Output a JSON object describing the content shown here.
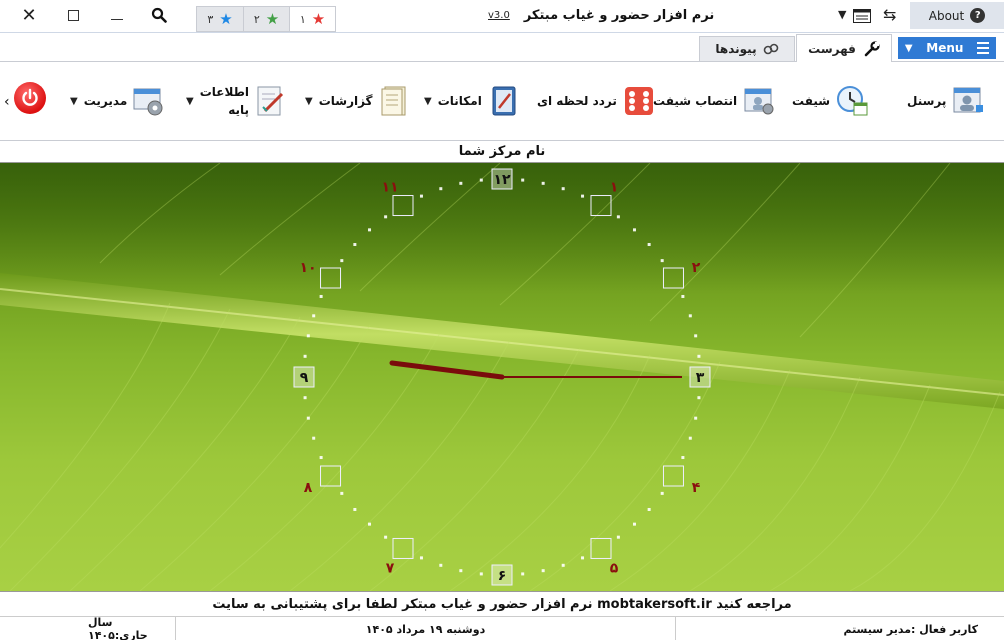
{
  "window": {
    "title": "نرم افزار حضور و غیاب مبتکر",
    "version": "v3.0",
    "about_label": "About"
  },
  "favorites": [
    {
      "label": "۱",
      "color": "#e53935"
    },
    {
      "label": "۲",
      "color": "#43a047"
    },
    {
      "label": "۳",
      "color": "#1e88e5"
    }
  ],
  "tabs": {
    "menu_button": "Menu",
    "index": "فهرست",
    "links": "پیوندها"
  },
  "ribbon": {
    "personnel": "پرسنل",
    "shift": "شیفت",
    "shift_assign": "انتصاب شیفت",
    "instant_traffic": "تردد لحظه ای",
    "facilities": "امکانات",
    "reports": "گزارشات",
    "base_info_line1": "اطلاعات",
    "base_info_line2": "پایه",
    "management": "مدیریت"
  },
  "center_name": "نام مرکز شما",
  "clock": {
    "numerals": [
      "۱۲",
      "۱",
      "۲",
      "۳",
      "۴",
      "۵",
      "۶",
      "۷",
      "۸",
      "۹",
      "۱۰",
      "۱۱"
    ],
    "hands_color": "#7a0c0c"
  },
  "support_text": "نرم افزار حضور و غیاب مبتکر لطفا برای پشتیبانی به سایت mobtakersoft.ir مراجعه کنید",
  "status": {
    "active_user": "کاربر فعال :مدیر سیستم",
    "date": "دوشنبه ۱۹ مرداد ۱۴۰۵",
    "current_year": "سال جاری:۱۴۰۵"
  }
}
